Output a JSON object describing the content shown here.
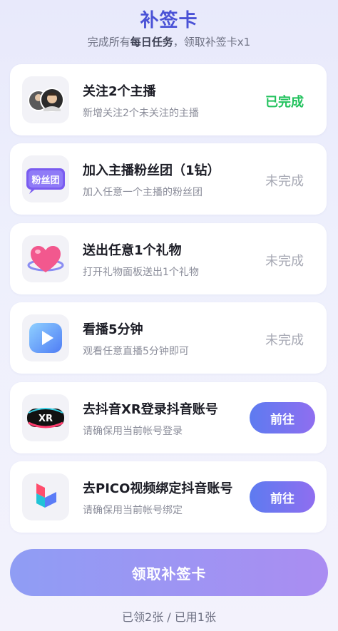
{
  "header": {
    "title": "补签卡",
    "subtitle_pre": "完成所有",
    "subtitle_em": "每日任务",
    "subtitle_post": "，领取补签卡x1"
  },
  "tasks": [
    {
      "title": "关注2个主播",
      "desc": "新增关注2个未关注的主播",
      "status": "已完成",
      "icon": "avatars-icon"
    },
    {
      "title": "加入主播粉丝团（1钻）",
      "desc": "加入任意一个主播的粉丝团",
      "status": "未完成",
      "icon": "fan-club-badge-icon",
      "badge_text": "粉丝团"
    },
    {
      "title": "送出任意1个礼物",
      "desc": "打开礼物面板送出1个礼物",
      "status": "未完成",
      "icon": "heart-gift-icon"
    },
    {
      "title": "看播5分钟",
      "desc": "观看任意直播5分钟即可",
      "status": "未完成",
      "icon": "play-icon"
    },
    {
      "title": "去抖音XR登录抖音账号",
      "desc": "请确保用当前帐号登录",
      "action": "前往",
      "icon": "xr-headset-icon",
      "badge_text": "XR"
    },
    {
      "title": "去PICO视频绑定抖音账号",
      "desc": "请确保用当前帐号绑定",
      "action": "前往",
      "icon": "pico-video-icon"
    }
  ],
  "claim_button": "领取补签卡",
  "footer": "已领2张 / 已用1张",
  "colors": {
    "accent": "#4a52d6",
    "done": "#22c25d",
    "todo": "#a7a9b4",
    "button_start": "#5d7bf0",
    "button_end": "#8f6ef0"
  }
}
